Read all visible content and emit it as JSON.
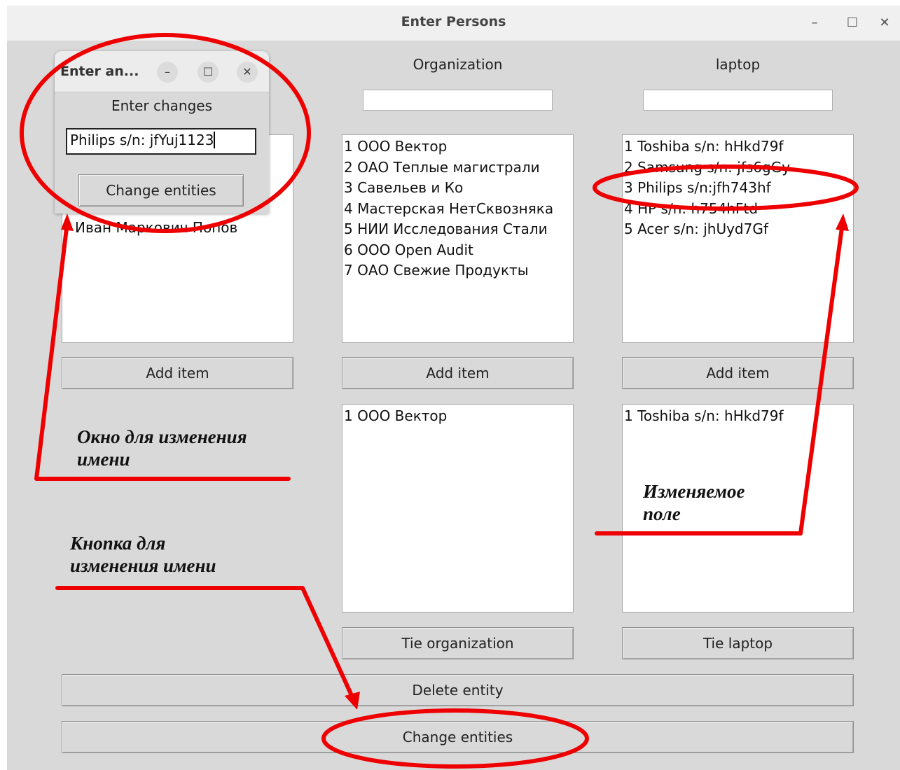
{
  "window": {
    "title": "Enter Persons",
    "controls": {
      "minimize": "–",
      "maximize": "☐",
      "close": "✕"
    }
  },
  "columns": {
    "persons": {
      "items": [
        "Иван Маркович Попов"
      ],
      "partial_item": "ич",
      "add_label": "Add item"
    },
    "organization": {
      "header": "Organization",
      "entry_value": "",
      "items": [
        "1  ООО Вектор",
        "2  ОАО Теплые магистрали",
        "3  Савельев и Ко",
        "4  Мастерская НетСквозняка",
        "5  НИИ Исследования Стали",
        "6  ООО Open Audit",
        "7  ОАО Свежие Продукты"
      ],
      "add_label": "Add item",
      "tied_items": [
        "1 ООО Вектор"
      ],
      "tie_label": "Tie organization"
    },
    "laptop": {
      "header": "laptop",
      "entry_value": "",
      "items": [
        "1  Toshiba s/n: hHkd79f",
        "2  Samsung s/n: jfs6gGy",
        "3  Philips s/n:jfh743hf",
        "4  HP s/n: h754hFtd",
        "5  Acer s/n: jhUyd7Gf"
      ],
      "add_label": "Add item",
      "tied_items": [
        "1 Toshiba s/n: hHkd79f"
      ],
      "tie_label": "Tie laptop"
    }
  },
  "buttons": {
    "delete": "Delete entity",
    "change": "Change entities"
  },
  "dialog": {
    "title": "Enter an...",
    "controls": {
      "minimize": "–",
      "maximize": "☐",
      "close": "✕"
    },
    "label": "Enter changes",
    "input_value": "Philips s/n: jfYuj1123",
    "button": "Change entities"
  },
  "annotations": {
    "window_note": [
      "Окно для изменения",
      "имени"
    ],
    "field_note": [
      "Изменяемое",
      "поле"
    ],
    "button_note": [
      "Кнопка для",
      "изменения имени"
    ],
    "color": "#ee0000"
  }
}
